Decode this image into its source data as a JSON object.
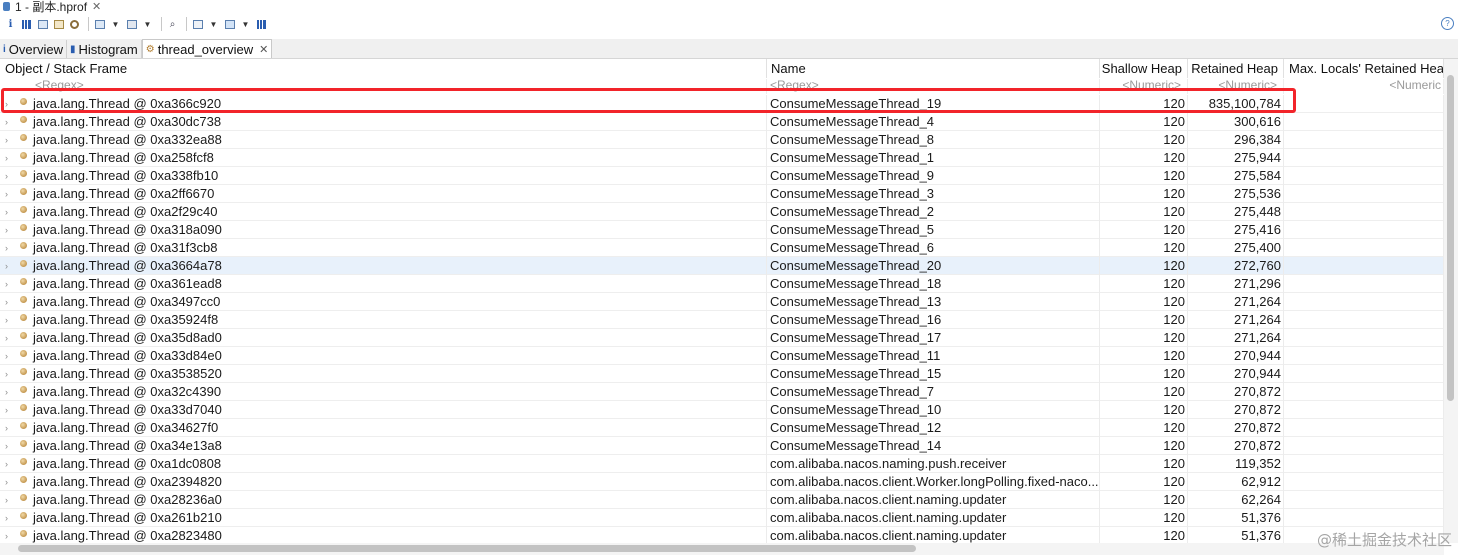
{
  "editor": {
    "title": "1 - 副本.hprof",
    "close_glyph": "✕"
  },
  "toolbar": {
    "items": [
      "info-icon",
      "histogram-icon",
      "dominator-tree-icon",
      "query-icon",
      "heap-dump-icon",
      "open-query-browser-icon",
      "query-browser-dropdown",
      "search-icon",
      "display-options-icon",
      "export-icon",
      "export-dropdown",
      "pin-icon"
    ]
  },
  "tabs": [
    {
      "label": "Overview",
      "icon": "info-icon",
      "active": false
    },
    {
      "label": "Histogram",
      "icon": "histogram-icon",
      "active": false
    },
    {
      "label": "thread_overview",
      "icon": "thread-icon",
      "active": true,
      "close": "✕"
    }
  ],
  "table": {
    "columns": [
      "Object / Stack Frame",
      "Name",
      "Shallow Heap",
      "Retained Heap",
      "Max. Locals' Retained Heap"
    ],
    "filters": [
      "<Regex>",
      "<Regex>",
      "<Numeric>",
      "<Numeric>",
      "<Numeric"
    ],
    "rows": [
      {
        "obj": "java.lang.Thread @ 0xa366c920",
        "name": "ConsumeMessageThread_19",
        "shallow": "120",
        "retained": "835,100,784"
      },
      {
        "obj": "java.lang.Thread @ 0xa30dc738",
        "name": "ConsumeMessageThread_4",
        "shallow": "120",
        "retained": "300,616"
      },
      {
        "obj": "java.lang.Thread @ 0xa332ea88",
        "name": "ConsumeMessageThread_8",
        "shallow": "120",
        "retained": "296,384"
      },
      {
        "obj": "java.lang.Thread @ 0xa258fcf8",
        "name": "ConsumeMessageThread_1",
        "shallow": "120",
        "retained": "275,944"
      },
      {
        "obj": "java.lang.Thread @ 0xa338fb10",
        "name": "ConsumeMessageThread_9",
        "shallow": "120",
        "retained": "275,584"
      },
      {
        "obj": "java.lang.Thread @ 0xa2ff6670",
        "name": "ConsumeMessageThread_3",
        "shallow": "120",
        "retained": "275,536"
      },
      {
        "obj": "java.lang.Thread @ 0xa2f29c40",
        "name": "ConsumeMessageThread_2",
        "shallow": "120",
        "retained": "275,448"
      },
      {
        "obj": "java.lang.Thread @ 0xa318a090",
        "name": "ConsumeMessageThread_5",
        "shallow": "120",
        "retained": "275,416"
      },
      {
        "obj": "java.lang.Thread @ 0xa31f3cb8",
        "name": "ConsumeMessageThread_6",
        "shallow": "120",
        "retained": "275,400"
      },
      {
        "obj": "java.lang.Thread @ 0xa3664a78",
        "name": "ConsumeMessageThread_20",
        "shallow": "120",
        "retained": "272,760"
      },
      {
        "obj": "java.lang.Thread @ 0xa361ead8",
        "name": "ConsumeMessageThread_18",
        "shallow": "120",
        "retained": "271,296"
      },
      {
        "obj": "java.lang.Thread @ 0xa3497cc0",
        "name": "ConsumeMessageThread_13",
        "shallow": "120",
        "retained": "271,264"
      },
      {
        "obj": "java.lang.Thread @ 0xa35924f8",
        "name": "ConsumeMessageThread_16",
        "shallow": "120",
        "retained": "271,264"
      },
      {
        "obj": "java.lang.Thread @ 0xa35d8ad0",
        "name": "ConsumeMessageThread_17",
        "shallow": "120",
        "retained": "271,264"
      },
      {
        "obj": "java.lang.Thread @ 0xa33d84e0",
        "name": "ConsumeMessageThread_11",
        "shallow": "120",
        "retained": "270,944"
      },
      {
        "obj": "java.lang.Thread @ 0xa3538520",
        "name": "ConsumeMessageThread_15",
        "shallow": "120",
        "retained": "270,944"
      },
      {
        "obj": "java.lang.Thread @ 0xa32c4390",
        "name": "ConsumeMessageThread_7",
        "shallow": "120",
        "retained": "270,872"
      },
      {
        "obj": "java.lang.Thread @ 0xa33d7040",
        "name": "ConsumeMessageThread_10",
        "shallow": "120",
        "retained": "270,872"
      },
      {
        "obj": "java.lang.Thread @ 0xa34627f0",
        "name": "ConsumeMessageThread_12",
        "shallow": "120",
        "retained": "270,872"
      },
      {
        "obj": "java.lang.Thread @ 0xa34e13a8",
        "name": "ConsumeMessageThread_14",
        "shallow": "120",
        "retained": "270,872"
      },
      {
        "obj": "java.lang.Thread @ 0xa1dc0808",
        "name": "com.alibaba.nacos.naming.push.receiver",
        "shallow": "120",
        "retained": "119,352"
      },
      {
        "obj": "java.lang.Thread @ 0xa2394820",
        "name": "com.alibaba.nacos.client.Worker.longPolling.fixed-naco...",
        "shallow": "120",
        "retained": "62,912"
      },
      {
        "obj": "java.lang.Thread @ 0xa28236a0",
        "name": "com.alibaba.nacos.client.naming.updater",
        "shallow": "120",
        "retained": "62,264"
      },
      {
        "obj": "java.lang.Thread @ 0xa261b210",
        "name": "com.alibaba.nacos.client.naming.updater",
        "shallow": "120",
        "retained": "51,376"
      },
      {
        "obj": "java.lang.Thread @ 0xa2823480",
        "name": "com.alibaba.nacos.client.naming.updater",
        "shallow": "120",
        "retained": "51,376"
      }
    ]
  },
  "watermark": "@稀土掘金技术社区",
  "colors": {
    "highlight": "#f2242a",
    "selected_row": "#e8f1fb"
  }
}
